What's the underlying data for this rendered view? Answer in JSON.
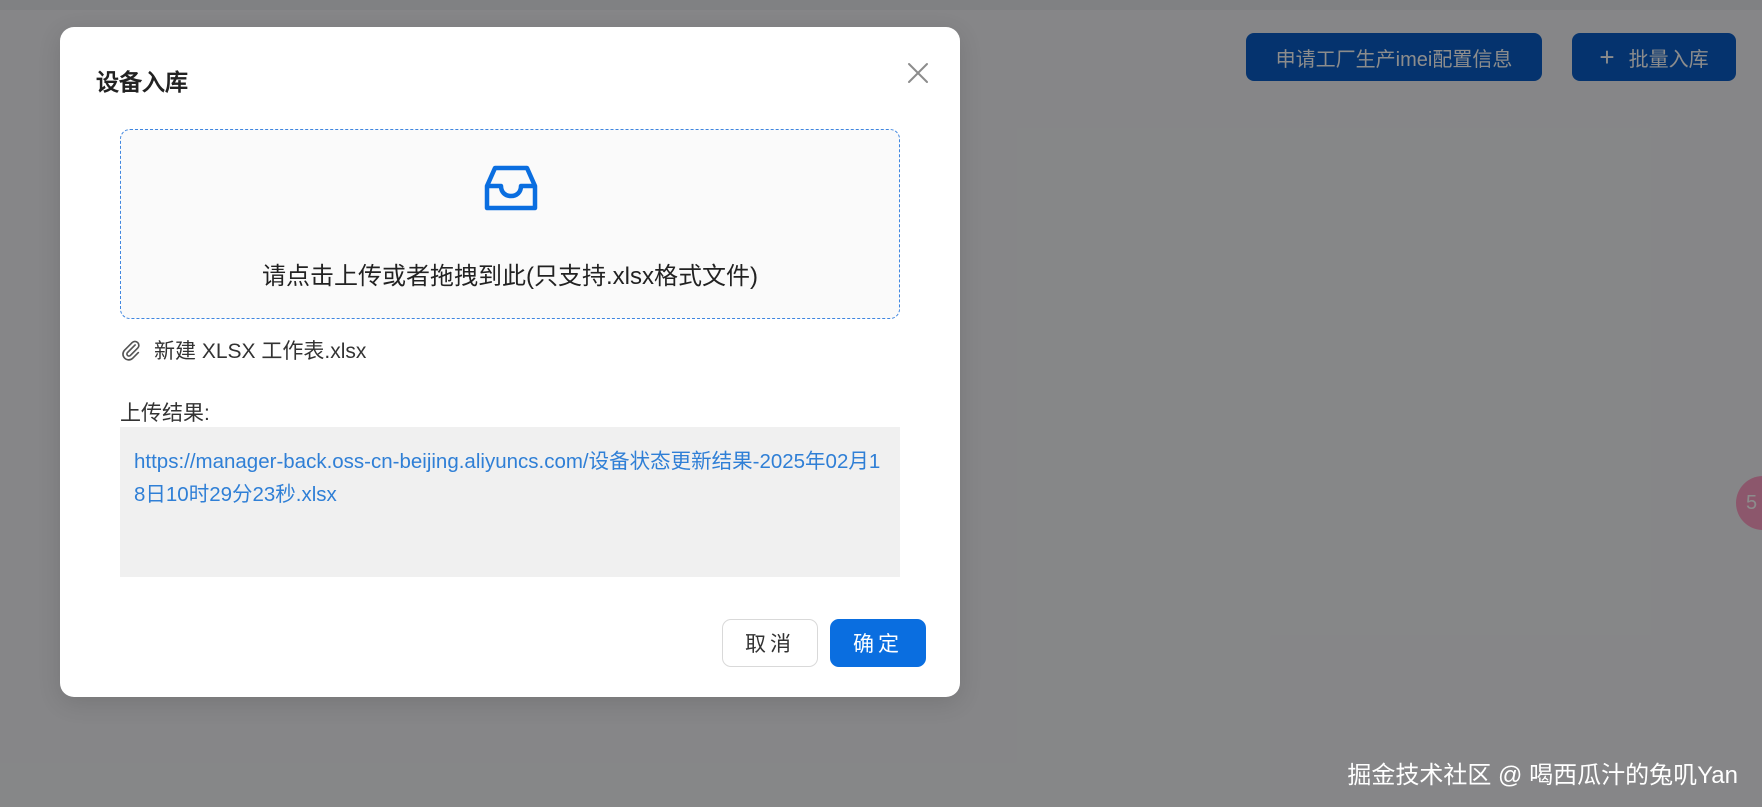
{
  "background": {
    "apply_button_label": "申请工厂生产imei配置信息",
    "batch_button_label": "批量入库",
    "batch_button_icon": "plus-icon",
    "float_badge_text": "5",
    "accent_color": "#0a5ec8"
  },
  "modal": {
    "title": "设备入库",
    "close_icon": "close-icon",
    "dropzone": {
      "icon": "inbox-icon",
      "text": "请点击上传或者拖拽到此(只支持.xlsx格式文件)"
    },
    "file": {
      "icon": "paperclip-icon",
      "name": "新建 XLSX 工作表.xlsx"
    },
    "result": {
      "label": "上传结果:",
      "link": "https://manager-back.oss-cn-beijing.aliyuncs.com/设备状态更新结果-2025年02月18日10时29分23秒.xlsx"
    },
    "buttons": {
      "cancel_label": "取消",
      "ok_label": "确定"
    },
    "primary_color": "#0a6ee0",
    "link_color": "#2f7fd6"
  },
  "watermark": "掘金技术社区 @ 喝西瓜汁的兔叽Yan"
}
